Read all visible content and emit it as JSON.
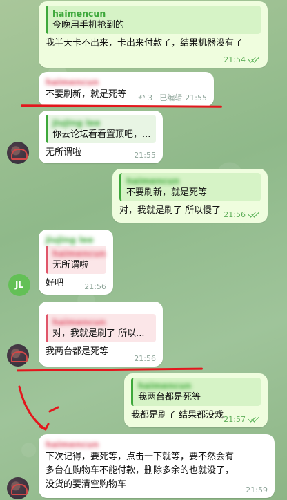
{
  "messages": [
    {
      "id": "m1",
      "dir": "out",
      "quote_name": "haimencun",
      "quote_text": "今晚用手机抢到的",
      "text": "我半天卡不出来，卡出来付款了，结果机器没有了",
      "time": "21:54"
    },
    {
      "id": "m2",
      "dir": "in",
      "sender": "haimencun",
      "text": "不要刷新，就是死等",
      "reply_count": "3",
      "edited": "已编辑",
      "time": "21:55"
    },
    {
      "id": "m3",
      "dir": "in",
      "quote_name": "jiujing lee",
      "quote_text": "你去论坛看看置顶吧，...",
      "text": "无所谓啦",
      "time": "21:55"
    },
    {
      "id": "m4",
      "dir": "out",
      "quote_name": "haimencun",
      "quote_text": "不要刷新，就是死等",
      "text": "对，我就是刷了 所以慢了",
      "time": "21:56"
    },
    {
      "id": "m5",
      "dir": "in",
      "sender": "jiujing lee",
      "quote_name": "haimencun",
      "quote_text": "无所谓啦",
      "text": "好吧",
      "time": "21:56",
      "avatar_initials": "JL"
    },
    {
      "id": "m6",
      "dir": "in",
      "quote_name": "haimencun",
      "quote_text": "对，我就是刷了 所以...",
      "text": "我两台都是死等",
      "time": "21:56"
    },
    {
      "id": "m7",
      "dir": "out",
      "quote_name": "haimencun",
      "quote_text": "我两台都是死等",
      "text": "我都是刷了 结果都没戏",
      "time": "21:57"
    },
    {
      "id": "m8",
      "dir": "in",
      "sender": "haimencun",
      "text": "下次记得，要死等，点击一下就等，要不然会有多台在购物车不能付款，删除多余的也就没了，没货的要清空购物车",
      "time": "21:59"
    }
  ],
  "colors": {
    "incoming_bg": "#ffffff",
    "outgoing_bg": "#effdde",
    "accent_green": "#3ea83b",
    "accent_pink": "#e0566a",
    "annotation_red": "#e3171d"
  }
}
